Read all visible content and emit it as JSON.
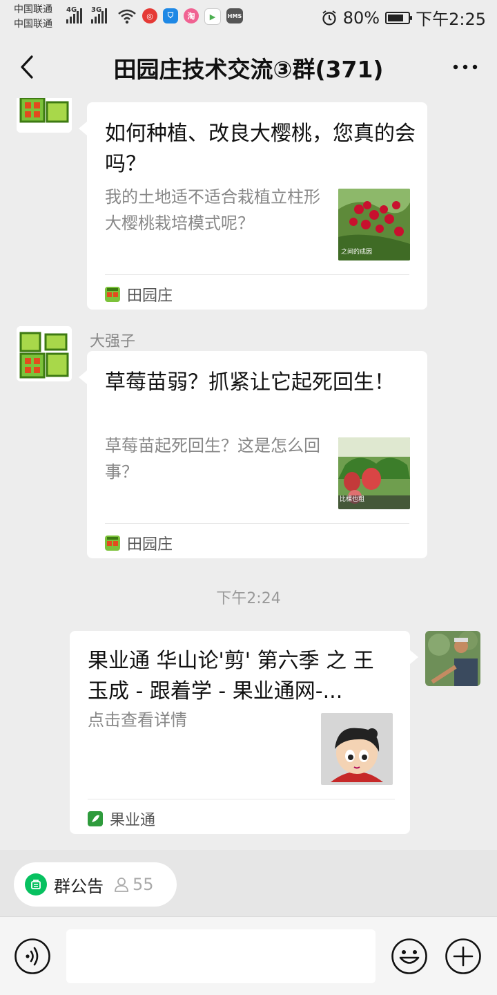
{
  "status_bar": {
    "carrier_1": "中国联通",
    "carrier_2": "中国联通",
    "net_1": "4G",
    "net_2": "3G",
    "app_icon_hms": "HMS",
    "app_icon_tao": "淘",
    "battery_percent_text": "80%",
    "battery_level": 0.8,
    "time": "下午2:25"
  },
  "header": {
    "title": "田园庄技术交流③群(371)"
  },
  "messages": [
    {
      "title": "如何种植、改良大樱桃，您真的会吗？",
      "desc": "我的土地适不适合栽植立柱形大樱桃栽培模式呢？",
      "thumb_caption": "之间的成因",
      "source": "田园庄"
    },
    {
      "sender": "大强子",
      "title": "草莓苗弱？抓紧让它起死回生！",
      "desc": "草莓苗起死回生？这是怎么回事？",
      "thumb_caption": "比棵也粗",
      "source": "田园庄"
    },
    {
      "title": "果业通 华山论'剪' 第六季 之 王玉成 - 跟着学 - 果业通网-...",
      "desc": "点击查看详情",
      "source": "果业通"
    }
  ],
  "timestamp": "下午2:24",
  "announcement": {
    "label": "群公告",
    "count": "55"
  },
  "input": {
    "placeholder": ""
  },
  "colors": {
    "background": "#ededed",
    "bubble": "#ffffff",
    "wechat_green": "#07c160",
    "muted_text": "#888888"
  },
  "icons": [
    "back-icon",
    "more-icon",
    "voice-icon",
    "emoji-icon",
    "plus-icon",
    "announcement-icon",
    "person-icon",
    "alarm-icon",
    "wifi-icon",
    "battery-icon"
  ]
}
